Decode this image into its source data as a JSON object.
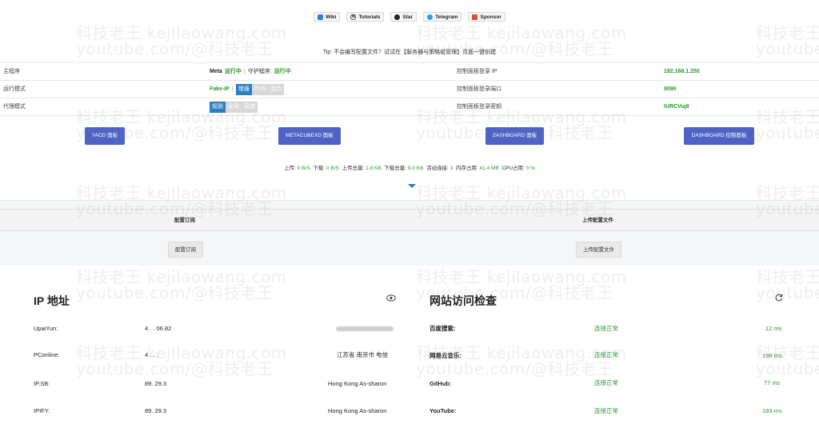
{
  "topbar": [
    {
      "label": "Wiki",
      "icon": "cloud-icon",
      "color": "#3a7bd5"
    },
    {
      "label": "Tutorials",
      "icon": "wikipedia-icon",
      "color": "#333333"
    },
    {
      "label": "Star",
      "icon": "github-icon",
      "color": "#222222"
    },
    {
      "label": "Telegram",
      "icon": "telegram-icon",
      "color": "#2aa3dd"
    },
    {
      "label": "Sponsor",
      "icon": "sponsor-icon",
      "color": "#e04b3b"
    }
  ],
  "tip": "Tip: 不会编写配置文件？试试在【服务器与策略组管理】页面一键创建",
  "info": {
    "main_label": "主程序",
    "main_name": "Meta",
    "main_status": "运行中",
    "guard_label": "守护程序:",
    "guard_status": "运行中",
    "run_mode_label": "运行模式",
    "run_mode_value": "Fake-IP",
    "run_modes": [
      "增强",
      "TUN",
      "混合"
    ],
    "proxy_mode_label": "代理模式",
    "proxy_modes": [
      "规则",
      "全局",
      "直连"
    ],
    "panel_ip_label": "控制面板登录 IP",
    "panel_ip": "192.168.1.250",
    "panel_port_label": "控制面板登录端口",
    "panel_port": "9090",
    "panel_key_label": "控制面板登录密钥",
    "panel_key": "IURCVuj8"
  },
  "panels": [
    "YACD 面板",
    "METACUBEXD 面板",
    "ZASHBOARD 面板",
    "DASHBOARD 控制面板"
  ],
  "stats": {
    "up_label": "上传:",
    "up": "0 B/S",
    "down_label": "下载:",
    "down": "0 B/S",
    "up_total_label": "上传总量:",
    "up_total": "1.8 KB",
    "down_total_label": "下载总量:",
    "down_total": "9.0 KB",
    "conn_label": "活动连接:",
    "conn": "3",
    "mem_label": "内存占用:",
    "mem": "41.4 MB",
    "cpu_label": "CPU占用:",
    "cpu": "0 %"
  },
  "config": {
    "sub_header": "配置订阅",
    "sub_button": "配置订阅",
    "upload_header": "上传配置文件",
    "upload_button": "上传配置文件"
  },
  "ip_card": {
    "title": "IP 地址",
    "rows": [
      {
        "label": "UpaiYun:",
        "ip": "4 . . 06.82",
        "loc": ""
      },
      {
        "label": "PConline:",
        "ip": "4 . . .",
        "loc": "江苏省 南京市 电信"
      },
      {
        "label": "IP.SB:",
        "ip": "89.    29.3",
        "loc": "Hong Kong As-sharon"
      },
      {
        "label": "IPIFY:",
        "ip": "89.    29.3",
        "loc": "Hong Kong As-sharon"
      }
    ]
  },
  "site_card": {
    "title": "网站访问检查",
    "rows": [
      {
        "label": "百度搜索:",
        "status": "连接正常",
        "latency": "12 ms"
      },
      {
        "label": "网易云音乐:",
        "status": "连接正常",
        "latency": "198 ms"
      },
      {
        "label": "GitHub:",
        "status": "连接正常",
        "latency": "77 ms"
      },
      {
        "label": "YouTube:",
        "status": "连接正常",
        "latency": "183 ms"
      }
    ]
  },
  "watermark": {
    "line1": "科技老王 kejilaowang.com",
    "line2": "youtube.com/@科技老王"
  }
}
